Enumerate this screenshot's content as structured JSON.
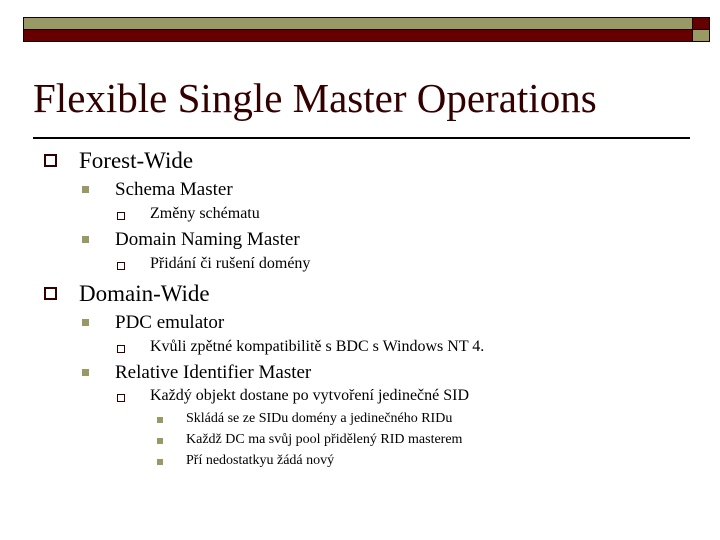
{
  "slide": {
    "title": "Flexible Single Master Operations",
    "colors": {
      "accent_dark": "#660000",
      "accent_olive": "#999966",
      "title_color": "#330000"
    },
    "bullets": {
      "forest_wide": {
        "label": "Forest-Wide",
        "schema_master": {
          "label": "Schema Master",
          "detail": "Změny schématu"
        },
        "domain_naming_master": {
          "label": "Domain Naming Master",
          "detail": "Přidání či rušení domény"
        }
      },
      "domain_wide": {
        "label": "Domain-Wide",
        "pdc_emulator": {
          "label": "PDC emulator",
          "detail": "Kvůli zpětné kompatibilitě s BDC s Windows NT 4."
        },
        "rid_master": {
          "label": "Relative Identifier Master",
          "detail": "Každý objekt dostane po vytvoření jedinečné SID",
          "subitems": [
            "Skládá se ze SIDu domény a jedinečného RIDu",
            "Každž DC ma svůj pool přidělený RID masterem",
            "Pří nedostatkyu žádá nový"
          ]
        }
      }
    }
  }
}
